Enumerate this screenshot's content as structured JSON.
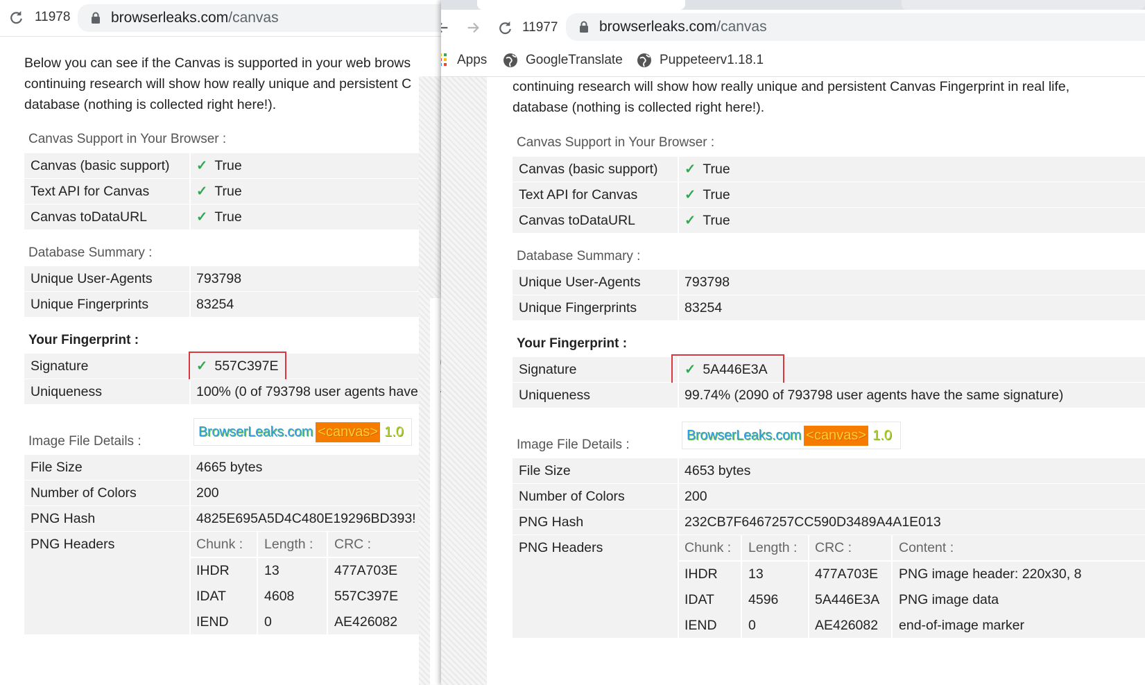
{
  "left": {
    "tab_count": "11978",
    "url": {
      "domain": "browserleaks.com",
      "path": "/canvas"
    },
    "paragraph": [
      "Below you can see if the Canvas is supported in your web brows",
      "continuing research will show how really unique and persistent C",
      "database (nothing is collected right here!)."
    ],
    "support_title": "Canvas Support in Your Browser :",
    "support_rows": [
      {
        "label": "Canvas (basic support)",
        "value": "True"
      },
      {
        "label": "Text API for Canvas",
        "value": "True"
      },
      {
        "label": "Canvas toDataURL",
        "value": "True"
      }
    ],
    "db_title": "Database Summary :",
    "db_rows": [
      {
        "label": "Unique User-Agents",
        "value": "793798"
      },
      {
        "label": "Unique Fingerprints",
        "value": "83254"
      }
    ],
    "fp_title": "Your Fingerprint :",
    "signature_label": "Signature",
    "signature_value": "557C397E",
    "uniqueness_label": "Uniqueness",
    "uniqueness_value": "100% (0 of 793798 user agents have",
    "image_title": "Image File Details :",
    "image_parts": [
      "BrowserLeaks.com",
      "<canvas>",
      "1.0"
    ],
    "file_rows": [
      {
        "label": "File Size",
        "value": "4665 bytes"
      },
      {
        "label": "Number of Colors",
        "value": "200"
      },
      {
        "label": "PNG Hash",
        "value": "4825E695A5D4C480E19296BD393!"
      }
    ],
    "png_headers_label": "PNG Headers",
    "png_cols": [
      "Chunk :",
      "Length :",
      "CRC :"
    ],
    "png_rows": [
      [
        "IHDR",
        "13",
        "477A703E"
      ],
      [
        "IDAT",
        "4608",
        "557C397E"
      ],
      [
        "IEND",
        "0",
        "AE426082"
      ]
    ]
  },
  "right": {
    "tab_count": "11977",
    "url": {
      "domain": "browserleaks.com",
      "path": "/canvas"
    },
    "bookmarks": [
      {
        "label": "Apps",
        "icon": "apps-grid-icon"
      },
      {
        "label": "GoogleTranslate",
        "icon": "globe-icon"
      },
      {
        "label": "Puppeteerv1.18.1",
        "icon": "globe-icon"
      }
    ],
    "paragraph": [
      "continuing research will show how really unique and persistent Canvas Fingerprint in real life,",
      "database (nothing is collected right here!)."
    ],
    "support_title": "Canvas Support in Your Browser :",
    "support_rows": [
      {
        "label": "Canvas (basic support)",
        "value": "True"
      },
      {
        "label": "Text API for Canvas",
        "value": "True"
      },
      {
        "label": "Canvas toDataURL",
        "value": "True"
      }
    ],
    "db_title": "Database Summary :",
    "db_rows": [
      {
        "label": "Unique User-Agents",
        "value": "793798"
      },
      {
        "label": "Unique Fingerprints",
        "value": "83254"
      }
    ],
    "fp_title": "Your Fingerprint :",
    "signature_label": "Signature",
    "signature_value": "5A446E3A",
    "uniqueness_label": "Uniqueness",
    "uniqueness_value": "99.74% (2090 of 793798 user agents have the same signature)",
    "image_title": "Image File Details :",
    "image_parts": [
      "BrowserLeaks.com",
      "<canvas>",
      "1.0"
    ],
    "file_rows": [
      {
        "label": "File Size",
        "value": "4653 bytes"
      },
      {
        "label": "Number of Colors",
        "value": "200"
      },
      {
        "label": "PNG Hash",
        "value": "232CB7F6467257CC590D3489A4A1E013"
      }
    ],
    "png_headers_label": "PNG Headers",
    "png_cols": [
      "Chunk :",
      "Length :",
      "CRC :",
      "Content :"
    ],
    "png_rows": [
      [
        "IHDR",
        "13",
        "477A703E",
        "PNG image header: 220x30, 8"
      ],
      [
        "IDAT",
        "4596",
        "5A446E3A",
        "PNG image data"
      ],
      [
        "IEND",
        "0",
        "AE426082",
        "end-of-image marker"
      ]
    ]
  },
  "sidebar_icons": [
    "pin-icon",
    "home-icon",
    "broadcast-icon",
    "code-icon",
    "puzzle-icon",
    "image-icon",
    "cube-icon",
    "text-height-icon",
    "lock-icon",
    "map-marker-icon",
    "stairs-icon",
    "wall-icon",
    "more-icon"
  ],
  "colors": {
    "check": "#2fa84f",
    "highlight_box": "#d9363e",
    "row_bg": "#f2f2f2",
    "canvas_orange": "#f57c00"
  }
}
